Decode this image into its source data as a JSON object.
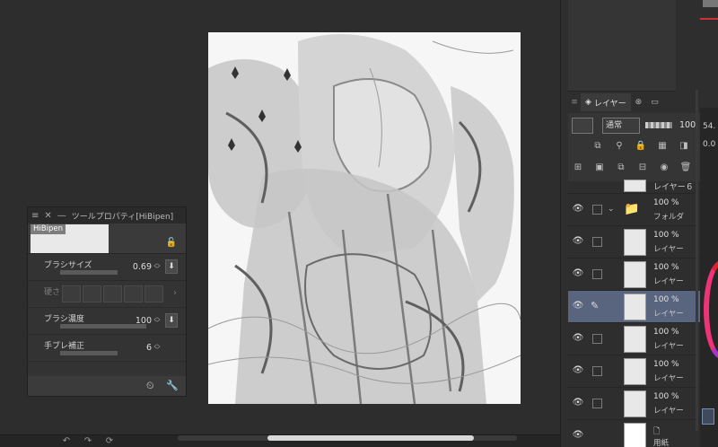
{
  "canvas": {
    "label": "illustration-canvas"
  },
  "tool_panel": {
    "title": "ツールプロパティ[HiBipen]",
    "brush_name": "HiBipen",
    "brush_size": {
      "label": "ブラシサイズ",
      "value": "0.69"
    },
    "hardness": {
      "label": "硬さ"
    },
    "brush_density": {
      "label": "ブラシ濃度",
      "value": "100"
    },
    "stabilization": {
      "label": "手ブレ補正",
      "value": "6"
    }
  },
  "layer_panel": {
    "tabs": [
      {
        "label": "レイヤー"
      }
    ],
    "blend_mode": "通常",
    "opacity": "100",
    "layers": [
      {
        "name": "レイヤー６",
        "opacity": ""
      },
      {
        "name": "フォルダ",
        "opacity": "100 %"
      },
      {
        "name": "レイヤー",
        "opacity": "100 %"
      },
      {
        "name": "レイヤー",
        "opacity": "100 %"
      },
      {
        "name": "レイヤー",
        "opacity": "100 %"
      },
      {
        "name": "レイヤー",
        "opacity": "100 %"
      },
      {
        "name": "レイヤー",
        "opacity": "100 %"
      },
      {
        "name": "レイヤー",
        "opacity": "100 %"
      },
      {
        "name": "用紙",
        "opacity": ""
      }
    ]
  },
  "far_strip": {
    "value1": "54.",
    "value2": "0.0"
  },
  "colors": {
    "accent_layer": "#59647e",
    "background": "#2d2d2d",
    "panel": "#333333"
  }
}
